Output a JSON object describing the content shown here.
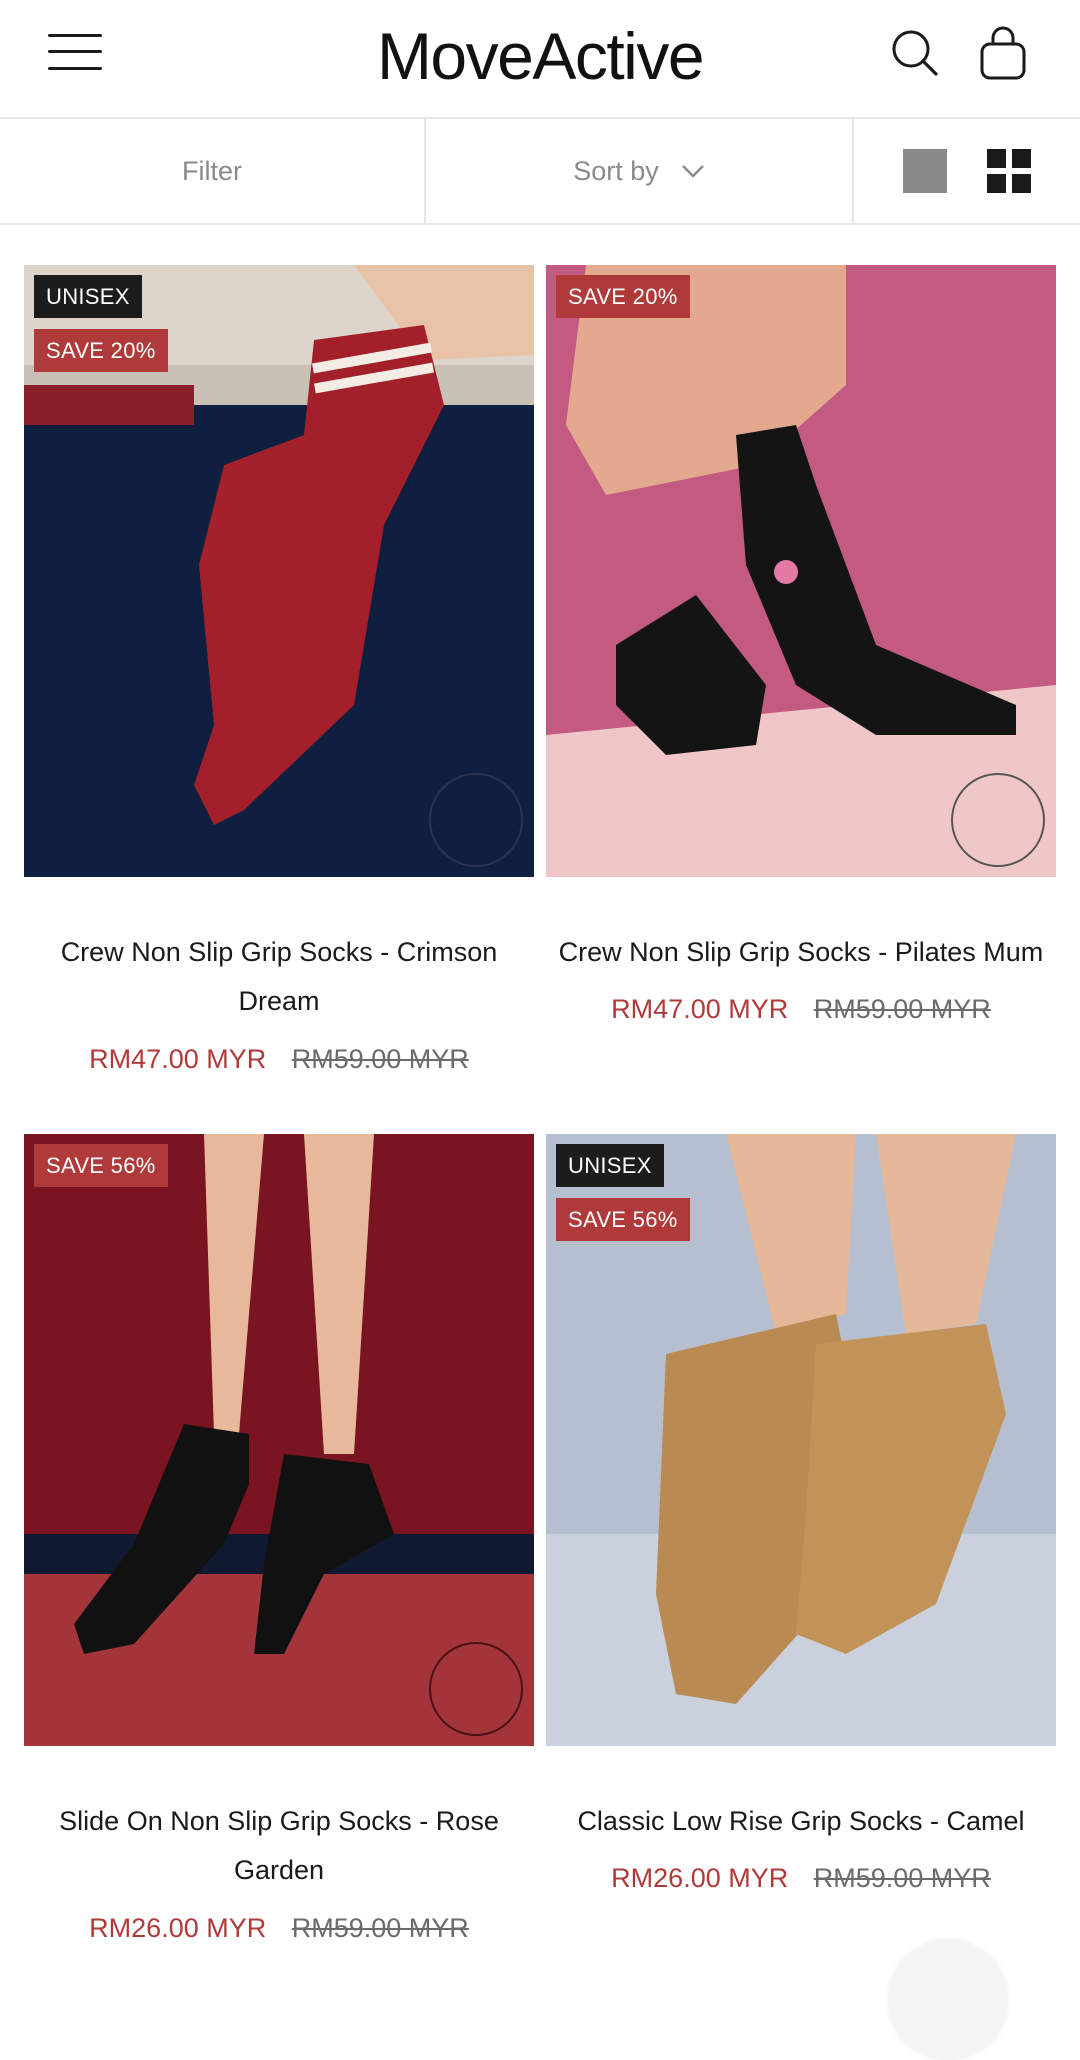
{
  "header": {
    "logo": "MoveActive",
    "menu_icon": "hamburger-menu-icon",
    "search_icon": "search-icon",
    "cart_icon": "shopping-bag-icon"
  },
  "toolbar": {
    "filter_label": "Filter",
    "sort_label": "Sort by",
    "sort_icon": "chevron-down-icon",
    "view_single_icon": "single-column-view-icon",
    "view_grid_icon": "grid-view-icon"
  },
  "products": [
    {
      "badges": [
        "UNISEX",
        "SAVE 20%"
      ],
      "title_line1": "Crew Non Slip Grip Socks - Crimson",
      "title_line2": "Dream",
      "price": "RM47.00 MYR",
      "compare_price": "RM59.00 MYR",
      "image_colors": {
        "top": "#ddd5cc",
        "bottom": "#0f1f3f",
        "sock": "#a3202a"
      }
    },
    {
      "badges": [
        "SAVE 20%"
      ],
      "title_line1": "Crew Non Slip Grip Socks - Pilates Mum",
      "title_line2": "",
      "price": "RM47.00 MYR",
      "compare_price": "RM59.00 MYR",
      "image_colors": {
        "top": "#c25a82",
        "bottom": "#f0c6c9",
        "sock": "#141414"
      }
    },
    {
      "badges": [
        "SAVE 56%"
      ],
      "title_line1": "Slide On Non Slip Grip Socks - Rose",
      "title_line2": "Garden",
      "price": "RM26.00 MYR",
      "compare_price": "RM59.00 MYR",
      "image_colors": {
        "top": "#7a1420",
        "bottom": "#a3343a",
        "sock": "#111111"
      }
    },
    {
      "badges": [
        "UNISEX",
        "SAVE 56%"
      ],
      "title_line1": "Classic Low Rise Grip Socks - Camel",
      "title_line2": "",
      "price": "RM26.00 MYR",
      "compare_price": "RM59.00 MYR",
      "image_colors": {
        "top": "#b5bfd0",
        "bottom": "#cbd1dc",
        "sock": "#b98a52"
      }
    }
  ],
  "colors": {
    "sale_red": "#b03a3a",
    "badge_dark": "#1c1c1c",
    "muted_gray": "#8a8a8a"
  }
}
